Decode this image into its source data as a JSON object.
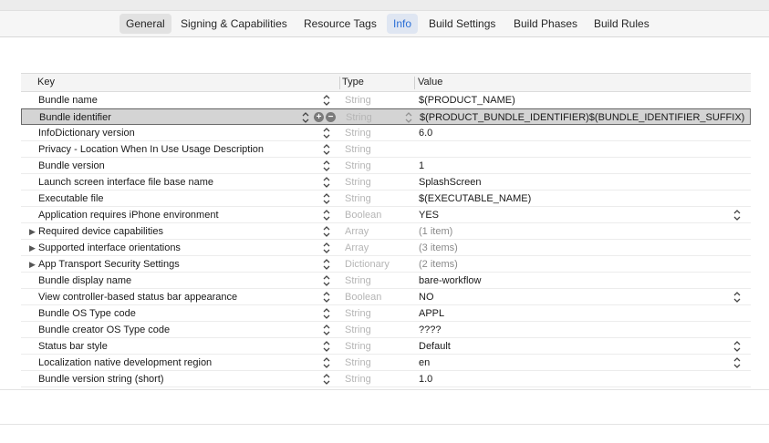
{
  "tabs": [
    {
      "label": "General"
    },
    {
      "label": "Signing & Capabilities"
    },
    {
      "label": "Resource Tags"
    },
    {
      "label": "Info"
    },
    {
      "label": "Build Settings"
    },
    {
      "label": "Build Phases"
    },
    {
      "label": "Build Rules"
    }
  ],
  "active_tab": "Info",
  "table": {
    "headers": {
      "key": "Key",
      "type": "Type",
      "value": "Value"
    },
    "rows": [
      {
        "key": "Bundle name",
        "type": "String",
        "value": "$(PRODUCT_NAME)"
      },
      {
        "key": "Bundle identifier",
        "type": "String",
        "value": "$(PRODUCT_BUNDLE_IDENTIFIER)$(BUNDLE_IDENTIFIER_SUFFIX)",
        "selected": true
      },
      {
        "key": "InfoDictionary version",
        "type": "String",
        "value": "6.0"
      },
      {
        "key": "Privacy - Location When In Use Usage Description",
        "type": "String",
        "value": ""
      },
      {
        "key": "Bundle version",
        "type": "String",
        "value": "1"
      },
      {
        "key": "Launch screen interface file base name",
        "type": "String",
        "value": "SplashScreen"
      },
      {
        "key": "Executable file",
        "type": "String",
        "value": "$(EXECUTABLE_NAME)"
      },
      {
        "key": "Application requires iPhone environment",
        "type": "Boolean",
        "value": "YES",
        "popup": true
      },
      {
        "key": "Required device capabilities",
        "type": "Array",
        "value": "(1 item)",
        "disclosure": true
      },
      {
        "key": "Supported interface orientations",
        "type": "Array",
        "value": "(3 items)",
        "disclosure": true
      },
      {
        "key": "App Transport Security Settings",
        "type": "Dictionary",
        "value": "(2 items)",
        "disclosure": true
      },
      {
        "key": "Bundle display name",
        "type": "String",
        "value": "bare-workflow"
      },
      {
        "key": "View controller-based status bar appearance",
        "type": "Boolean",
        "value": "NO",
        "popup": true
      },
      {
        "key": "Bundle OS Type code",
        "type": "String",
        "value": "APPL"
      },
      {
        "key": "Bundle creator OS Type code",
        "type": "String",
        "value": "????"
      },
      {
        "key": "Status bar style",
        "type": "String",
        "value": "Default",
        "popup": true
      },
      {
        "key": "Localization native development region",
        "type": "String",
        "value": "en",
        "popup": true
      },
      {
        "key": "Bundle version string (short)",
        "type": "String",
        "value": "1.0"
      }
    ]
  },
  "icons": {
    "stepper": "up-down-chevron-icon",
    "add": "plus-circle-icon",
    "remove": "minus-circle-icon",
    "disclosure": "disclosure-triangle-icon"
  },
  "colors": {
    "accent": "#2b6fd6",
    "selected_row": "#d4d4d4"
  }
}
